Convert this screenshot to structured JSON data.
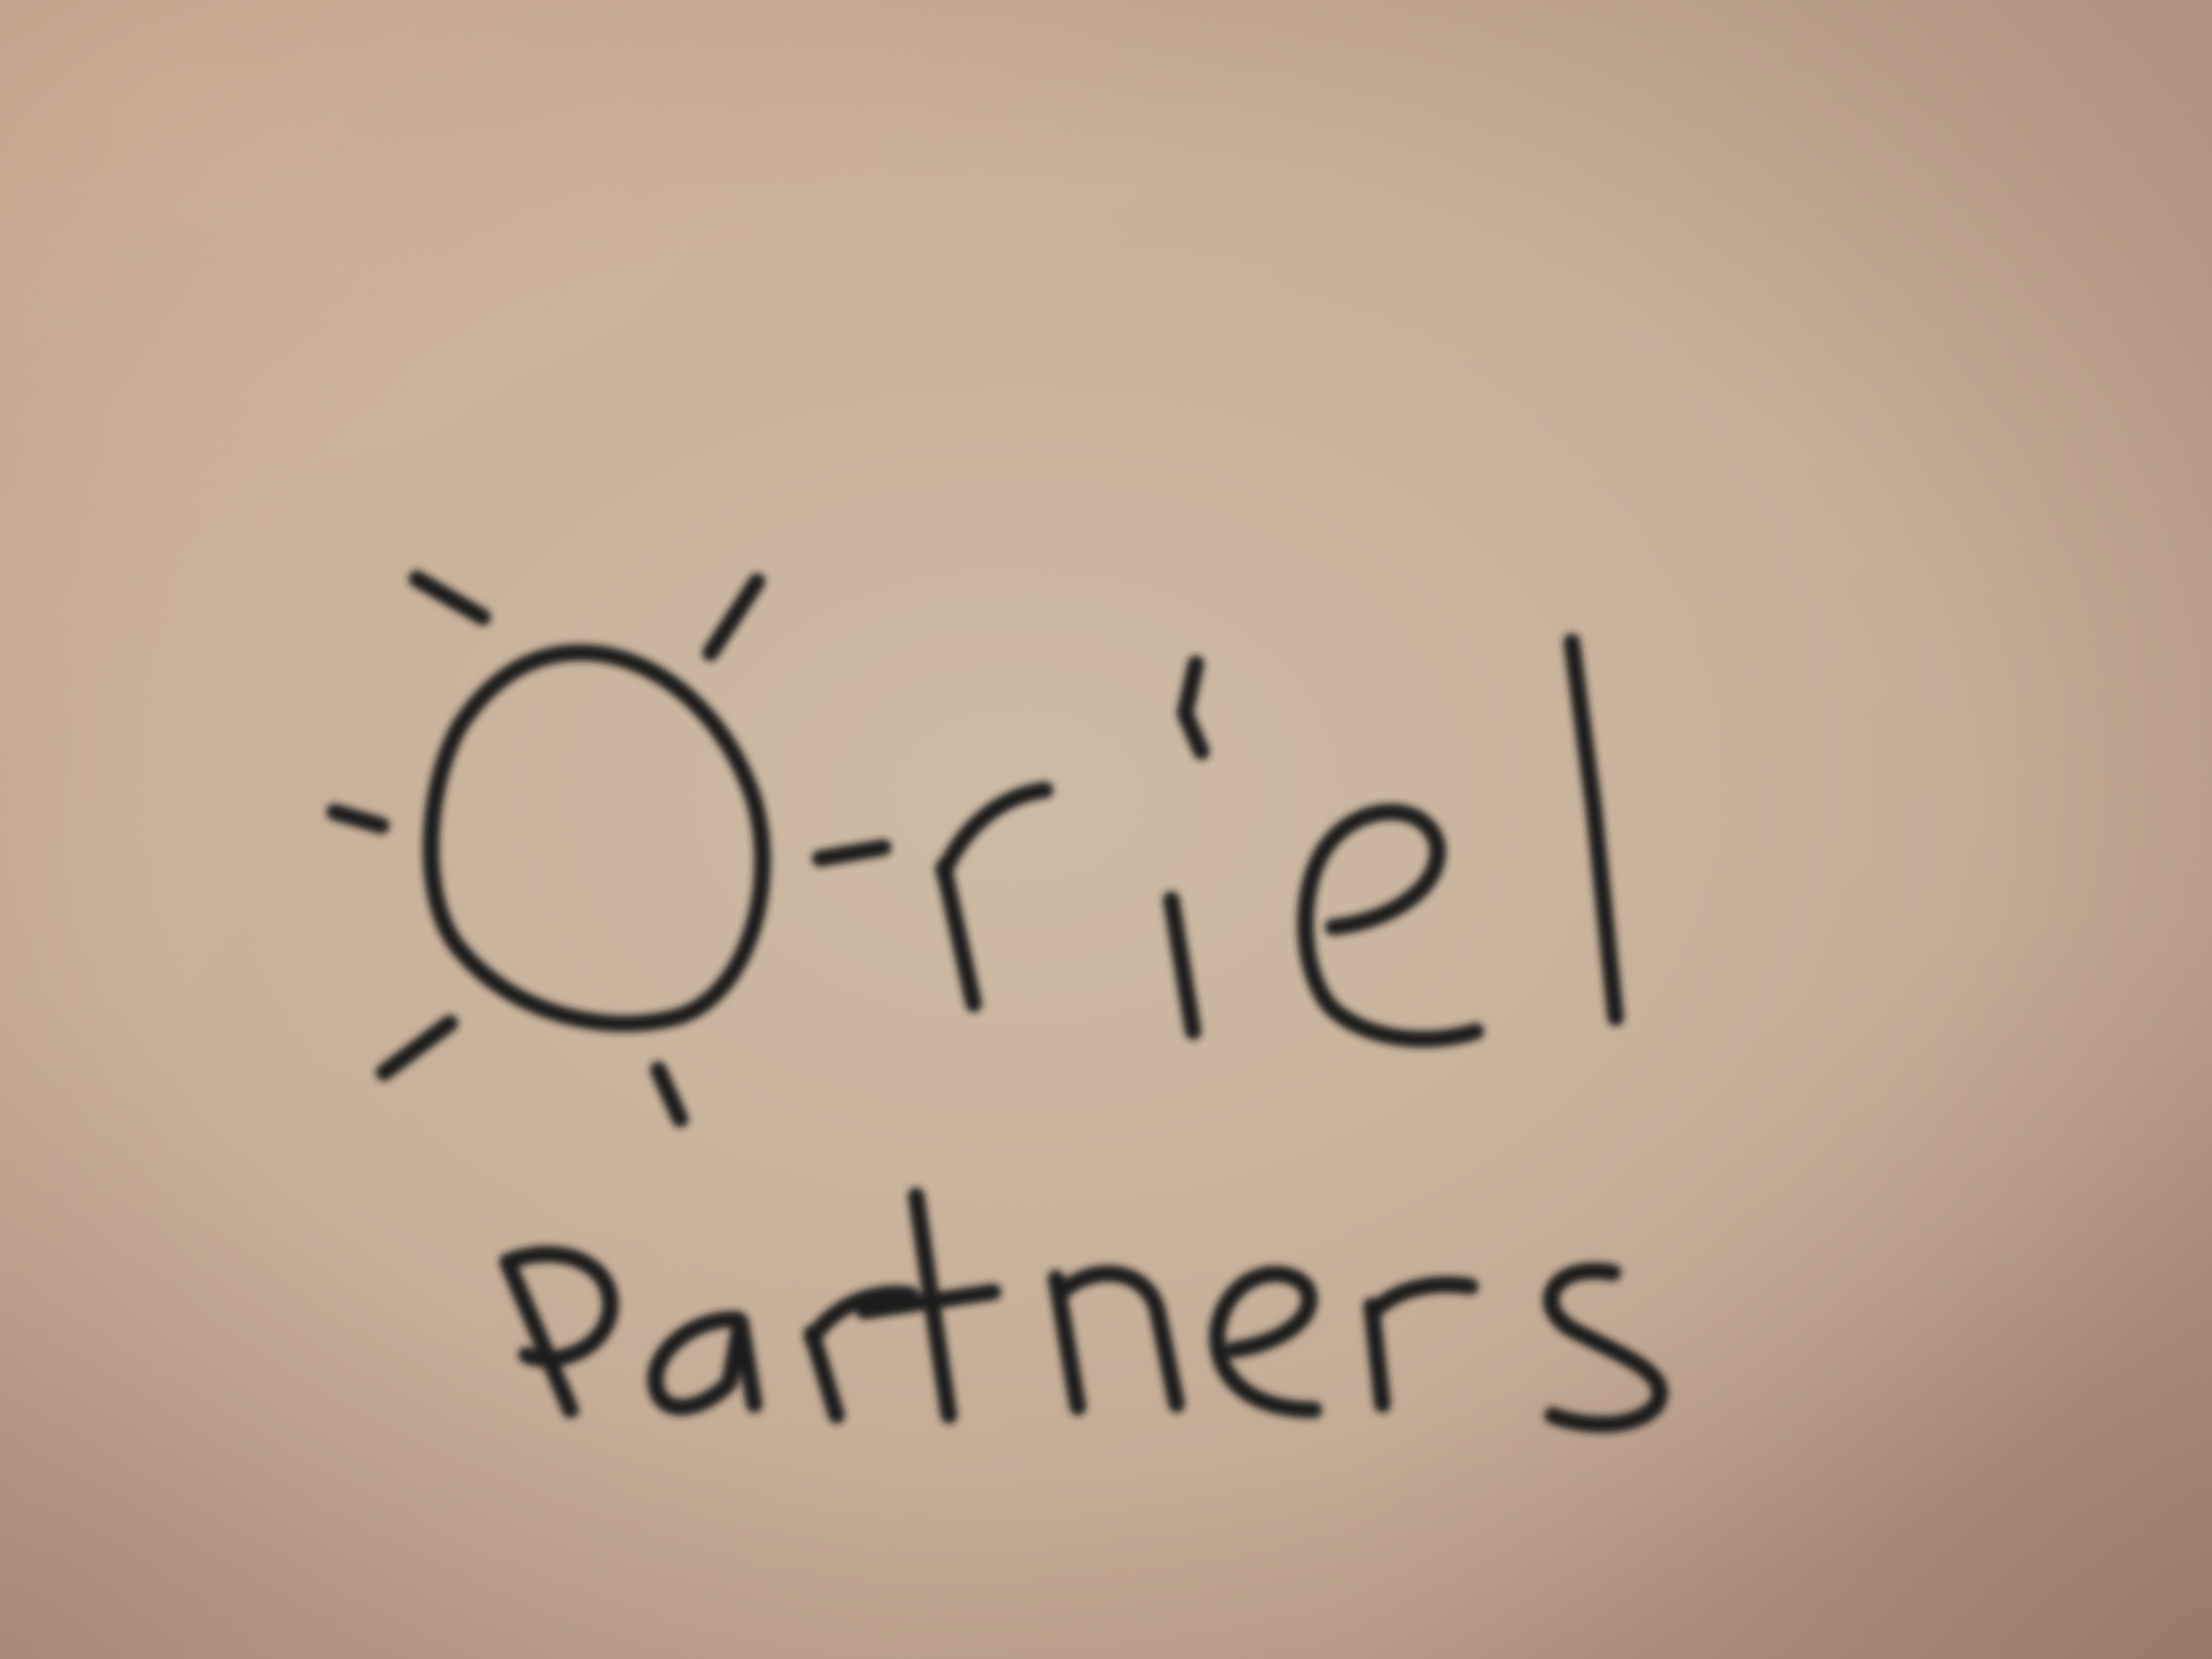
{
  "logo": {
    "name": "Oriel",
    "tagline": "Partners",
    "icon": "sun-icon"
  },
  "colors": {
    "paper": "#c9b39d",
    "ink": "#1c1a1a"
  }
}
